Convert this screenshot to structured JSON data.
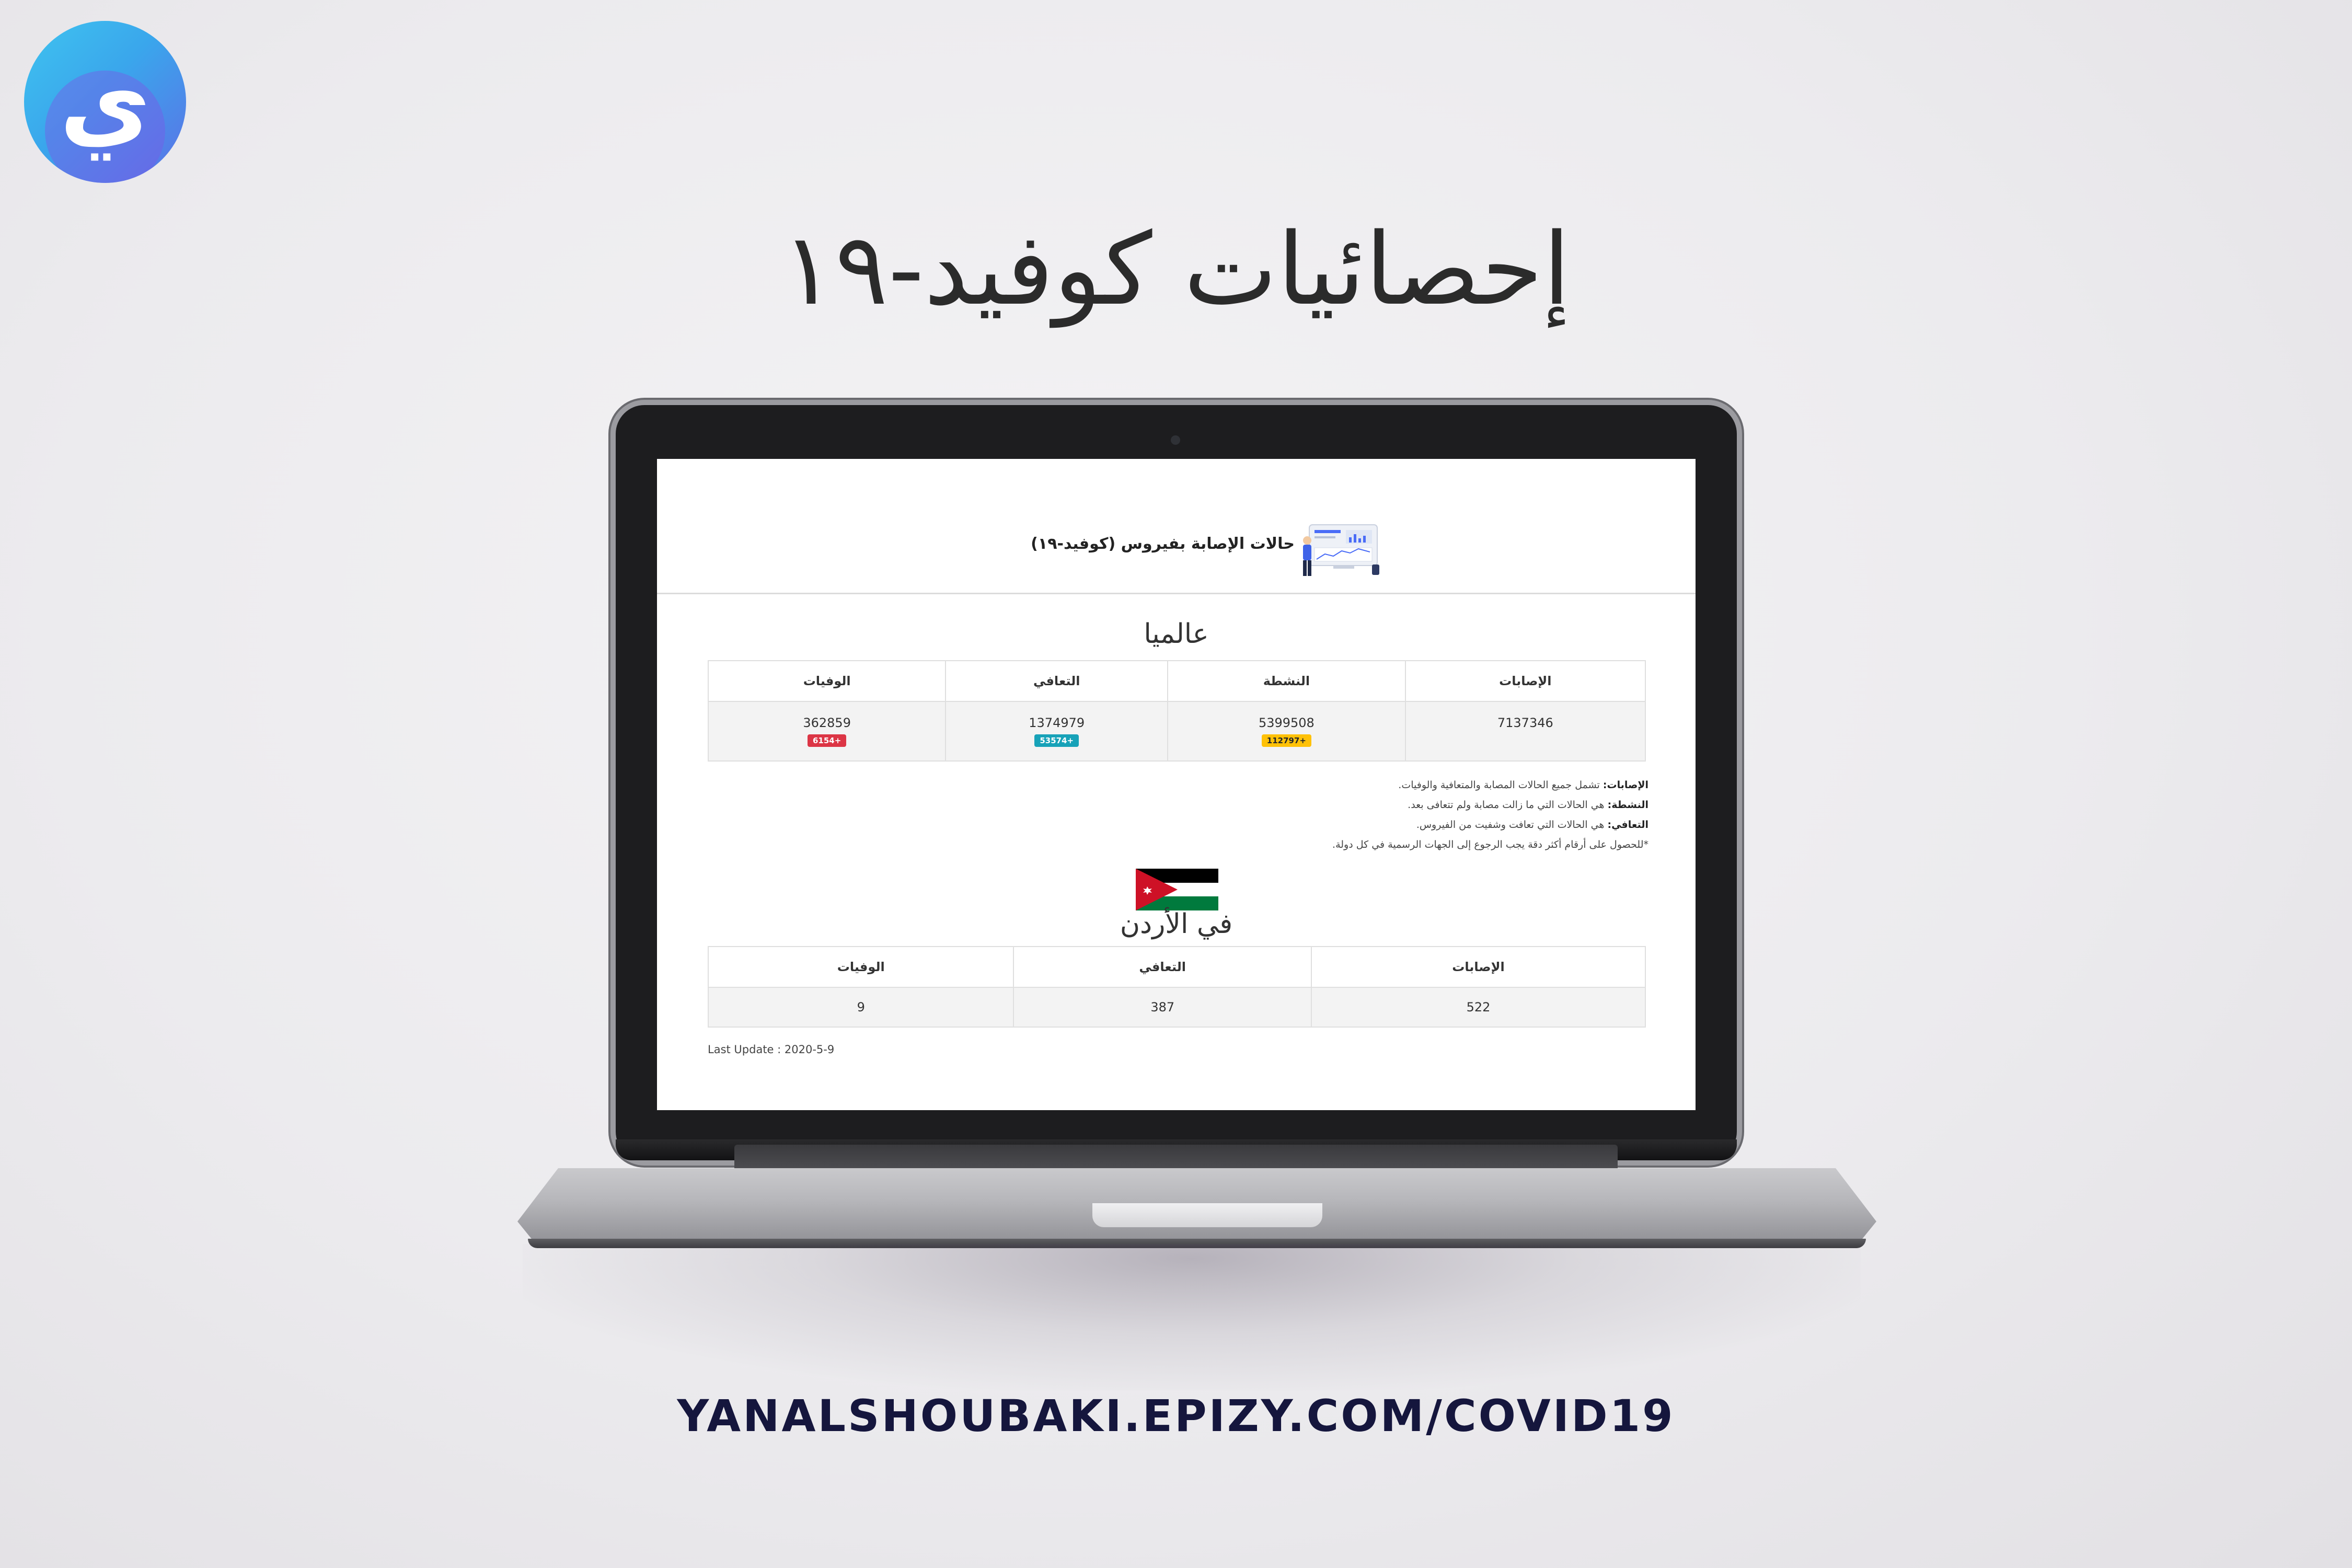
{
  "logo": {
    "glyph": "ي"
  },
  "headline": "إحصائيات كوفيد-١٩",
  "site": {
    "header_title": "حالات الإصابة بفيروس (كوفيد-١٩)"
  },
  "world": {
    "title": "عالميا",
    "headers": [
      "الإصابات",
      "النشطة",
      "التعافي",
      "الوفيات"
    ],
    "values": [
      "7137346",
      "5399508",
      "1374979",
      "362859"
    ],
    "badges": [
      "",
      "+112797",
      "+53574",
      "+6154"
    ]
  },
  "notes": [
    {
      "term": "الإصابات:",
      "text": " تشمل جميع الحالات المصابة والمتعافية والوفيات."
    },
    {
      "term": "النشطة:",
      "text": " هي الحالات التي ما زالت مصابة ولم تتعافى بعد."
    },
    {
      "term": "التعافي:",
      "text": " هي الحالات التي تعافت وشفيت من الفيروس."
    },
    {
      "term": "",
      "text": "*للحصول على أرقام أكثر دقة يجب الرجوع إلى الجهات الرسمية في كل دولة."
    }
  ],
  "jordan": {
    "title": "في الأردن",
    "headers": [
      "الإصابات",
      "التعافي",
      "الوفيات"
    ],
    "values": [
      "522",
      "387",
      "9"
    ]
  },
  "last_update": "Last Update : 2020-5-9",
  "url": "YANALSHOUBAKI.EPIZY.COM/COVID19",
  "colors": {
    "badge_active": "#ffc107",
    "badge_recovered": "#17a2b8",
    "badge_deaths": "#dc3545",
    "url_text": "#15163d"
  }
}
